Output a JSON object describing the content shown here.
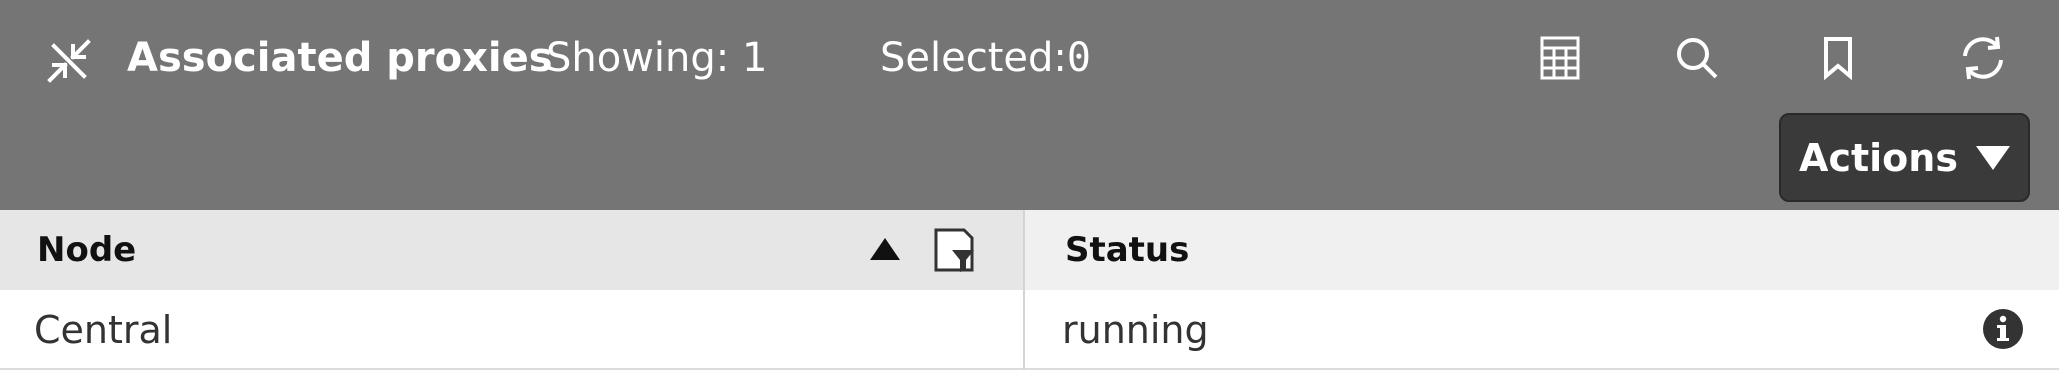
{
  "header": {
    "title": "Associated proxies",
    "showing_label": "Showing:",
    "showing_count": "1",
    "selected_label": "Selected:",
    "selected_count": "0",
    "icons": [
      "collapse-arrows-icon",
      "table-icon",
      "search-icon",
      "bookmark-icon",
      "refresh-icon"
    ],
    "actions_label": "Actions"
  },
  "table": {
    "columns": [
      "Node",
      "Status"
    ],
    "rows": [
      {
        "node": "Central",
        "status": "running"
      }
    ]
  },
  "colors": {
    "header_bg": "#757575",
    "actions_bg": "#3a3a3a",
    "table_header_bg": "#f0f0f0",
    "sorted_column_bg": "#e6e6e6"
  }
}
